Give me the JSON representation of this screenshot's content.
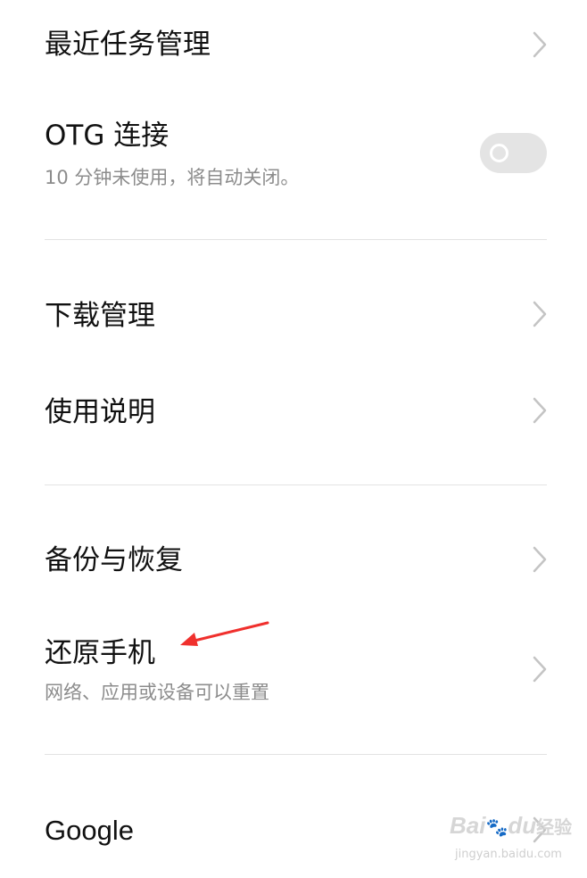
{
  "items": [
    {
      "title": "最近任务管理",
      "type": "link"
    },
    {
      "title": "OTG 连接",
      "subtitle": "10 分钟未使用，将自动关闭。",
      "type": "toggle",
      "toggle_on": false
    },
    {
      "title": "下载管理",
      "type": "link"
    },
    {
      "title": "使用说明",
      "type": "link"
    },
    {
      "title": "备份与恢复",
      "type": "link"
    },
    {
      "title": "还原手机",
      "subtitle": "网络、应用或设备可以重置",
      "type": "link",
      "annotated": true
    },
    {
      "title": "Google",
      "type": "link"
    }
  ],
  "annotation": {
    "icon": "red-arrow-icon",
    "color": "#f0302d"
  },
  "watermark": {
    "brand": "Bai",
    "brand_mark": "du",
    "brand_cn": "经验",
    "url": "jingyan.baidu.com"
  },
  "colors": {
    "divider": "#e3e3e3",
    "chevron": "#c4c4c4",
    "toggle_off": "#e4e4e4",
    "subtitle": "#8c8c8c"
  }
}
